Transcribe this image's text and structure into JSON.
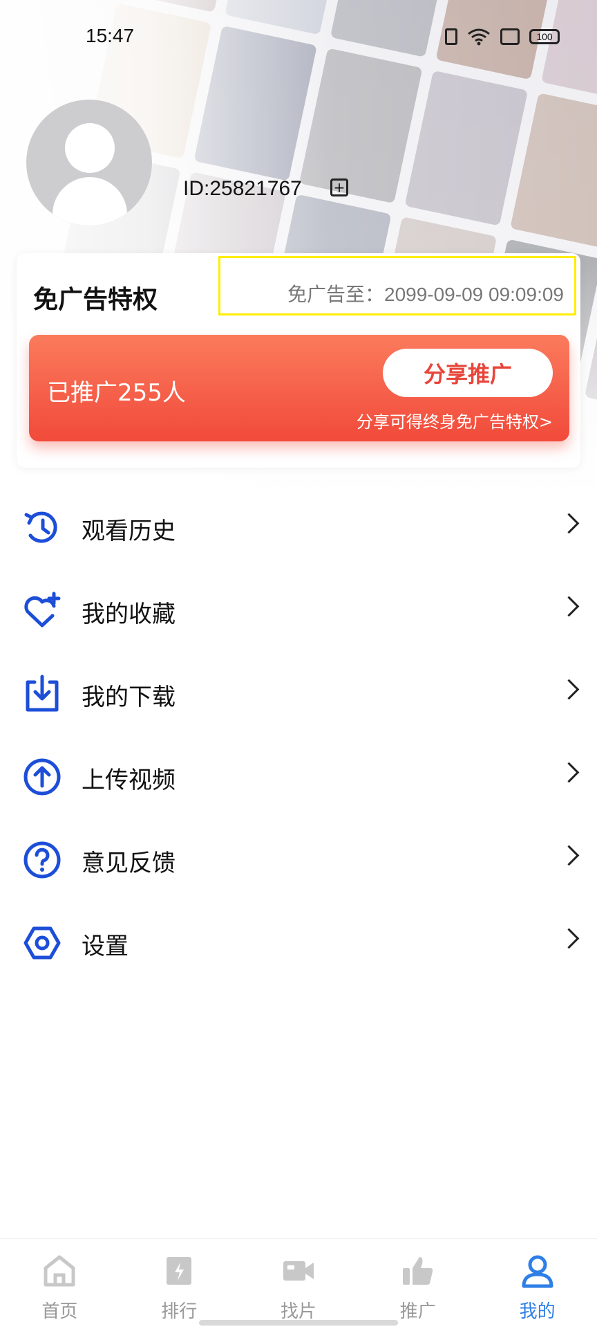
{
  "status_bar": {
    "time": "15:47",
    "battery": "100"
  },
  "profile": {
    "id_text": "ID:25821767"
  },
  "ad_free": {
    "title": "免广告特权",
    "expire_text": "免广告至：2099-09-09 09:09:09"
  },
  "promo": {
    "count_text": "已推广255人",
    "share_label": "分享推广",
    "tip": "分享可得终身免广告特权>"
  },
  "menu": [
    {
      "label": "观看历史",
      "icon": "history-icon"
    },
    {
      "label": "我的收藏",
      "icon": "favorite-icon"
    },
    {
      "label": "我的下载",
      "icon": "download-icon"
    },
    {
      "label": "上传视频",
      "icon": "upload-icon"
    },
    {
      "label": "意见反馈",
      "icon": "feedback-icon"
    },
    {
      "label": "设置",
      "icon": "settings-icon"
    }
  ],
  "tabs": [
    {
      "label": "首页",
      "icon": "home-icon",
      "active": false
    },
    {
      "label": "排行",
      "icon": "ranking-icon",
      "active": false
    },
    {
      "label": "找片",
      "icon": "video-camera-icon",
      "active": false
    },
    {
      "label": "推广",
      "icon": "thumbs-up-icon",
      "active": false
    },
    {
      "label": "我的",
      "icon": "user-icon",
      "active": true
    }
  ],
  "colors": {
    "accent_blue": "#1d4ed8",
    "active_tab": "#2e7fe6",
    "promo_red": "#f14a3a",
    "highlight_box": "#ffee00"
  }
}
